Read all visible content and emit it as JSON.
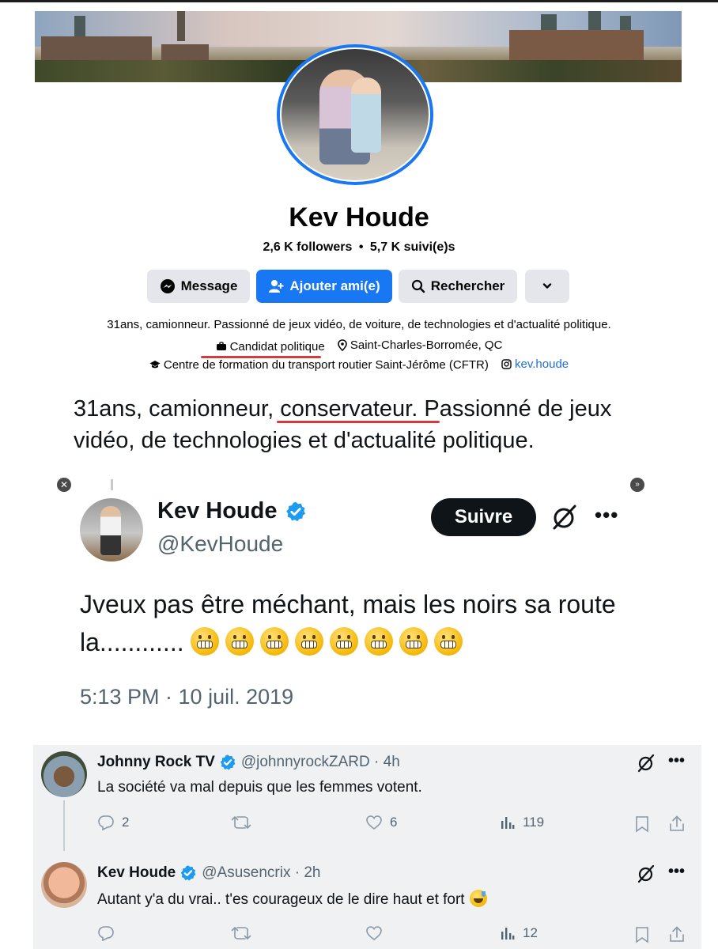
{
  "facebook": {
    "name": "Kev Houde",
    "followers": "2,6 K followers",
    "separator": "•",
    "following": "5,7 K suivi(e)s",
    "buttons": {
      "message": "Message",
      "add_friend": "Ajouter ami(e)",
      "search": "Rechercher"
    },
    "bio": "31ans, camionneur. Passionné de jeux vidéo, de voiture, de technologies et d'actualité politique.",
    "category": "Candidat politique",
    "location": "Saint-Charles-Borromée, QC",
    "education": "Centre de formation du transport routier Saint-Jérôme (CFTR)",
    "instagram": "kev.houde",
    "accent_color": "#1877f2",
    "highlight_color": "#d63b3b"
  },
  "x_bio": {
    "part1": "31ans, camionneur",
    "comma": ", ",
    "highlight": "conservateur.",
    "part2": " Passionné de jeux vidéo, de technologies et d'actualité politique."
  },
  "tweet": {
    "name": "Kev Houde",
    "handle": "@KevHoude",
    "follow_label": "Suivre",
    "more": "•••",
    "text": "Jveux pas être méchant, mais les noirs sa route la............",
    "emoji": "grimacing-face",
    "emoji_count": 8,
    "time": "5:13 PM · 10 juil. 2019"
  },
  "replies": [
    {
      "name": "Johnny Rock TV",
      "handle": "@johnnyrockZARD · 4h",
      "text": "La société va mal depuis que les femmes votent.",
      "replies": "2",
      "retweets": "",
      "likes": "6",
      "views": "119"
    },
    {
      "name": "Kev Houde",
      "handle": "@Asusencrix · 2h",
      "text": "Autant y'a du vrai.. t'es courageux de le dire haut et fort",
      "emoji": "grinning-sweat-face",
      "replies": "",
      "retweets": "",
      "likes": "",
      "views": "12"
    }
  ],
  "more_dots": "•••",
  "verified_color": "#1d9bf0"
}
